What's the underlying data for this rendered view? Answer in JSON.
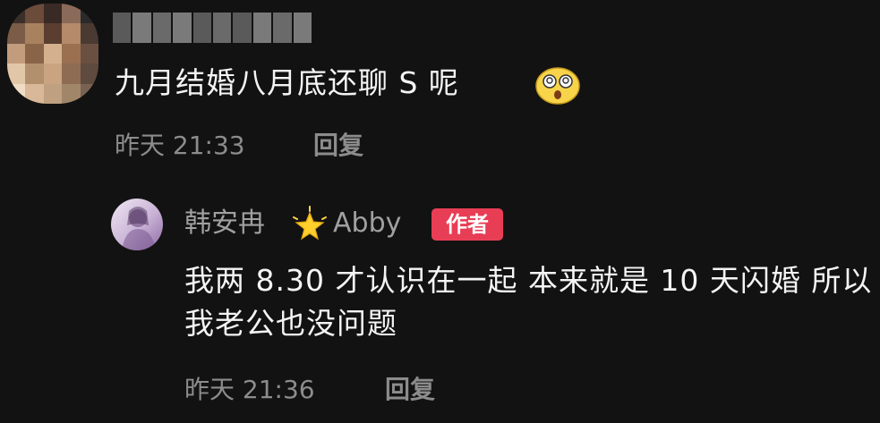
{
  "comments": [
    {
      "avatar": {
        "icon": "pixelated-avatar",
        "pixel_colors": [
          "#3b2f2a",
          "#6b4b3a",
          "#3a2a25",
          "#8a6a58",
          "#2a2a2a",
          "#7a5c48",
          "#a8825f",
          "#5a3e30",
          "#b48a6a",
          "#4a3a32",
          "#c29c7c",
          "#8a6448",
          "#d4b08e",
          "#9a7050",
          "#6a5040",
          "#e2c6a8",
          "#b2906e",
          "#caa480",
          "#8e6c54",
          "#5e4a3e",
          "#f0dcc4",
          "#d8b898",
          "#bfa080",
          "#a2866a",
          "#7a6252"
        ]
      },
      "username_blurred": true,
      "text": "九月结婚八月底还聊 S 呢",
      "emoji": "dizzy-face-emoji",
      "time": "昨天 21:33",
      "reply_label": "回复"
    },
    {
      "avatar": {
        "icon": "purple-avatar"
      },
      "author_name": "韩安冉",
      "author_icon": "glowing-star-icon",
      "author_suffix": "Abby",
      "badge": "作者",
      "badge_color": "#e83e55",
      "text": "我两 8.30 才认识在一起 本来就是 10 天闪婚 所以我老公也没问题",
      "time": "昨天 21:36",
      "reply_label": "回复"
    }
  ],
  "colors": {
    "background": "#121212",
    "primary_text": "#f4f4f4",
    "secondary_text": "#8c8c8c",
    "author_name_text": "#a0a0a0"
  }
}
